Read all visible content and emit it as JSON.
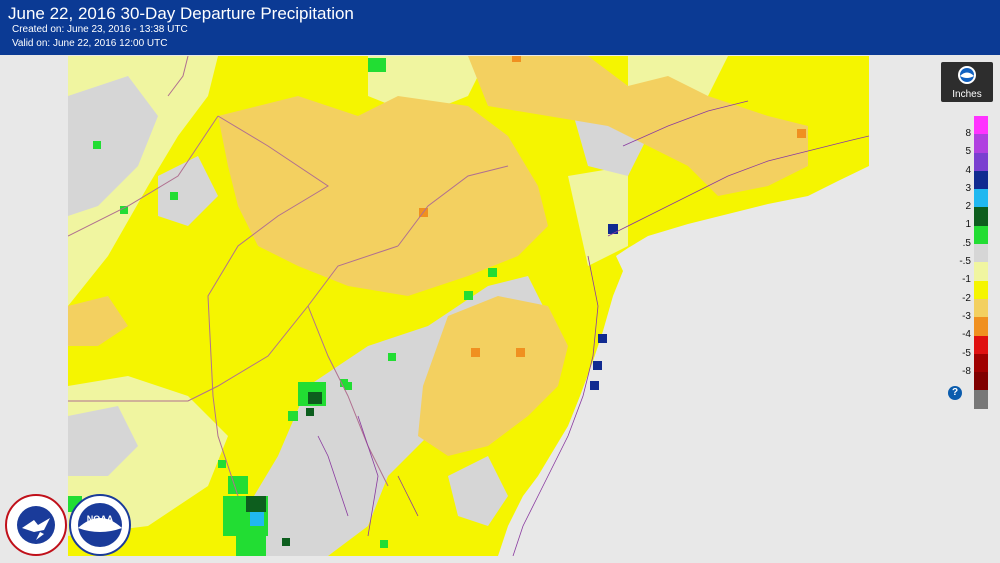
{
  "header": {
    "title": "June 22, 2016 30-Day Departure Precipitation",
    "created": "Created on: June 23, 2016 - 13:38 UTC",
    "valid": "Valid on: June 22, 2016 12:00 UTC"
  },
  "legend": {
    "units": "Inches",
    "help_label": "?",
    "entries": [
      {
        "label": "8",
        "color": "#ff33ff"
      },
      {
        "label": "5",
        "color": "#b040e0"
      },
      {
        "label": "4",
        "color": "#7a3fd0"
      },
      {
        "label": "3",
        "color": "#102a90"
      },
      {
        "label": "2",
        "color": "#20b8f0"
      },
      {
        "label": "1",
        "color": "#0d5e1e"
      },
      {
        "label": ".5",
        "color": "#22dd33"
      },
      {
        "label": "-.5",
        "color": "#d6d6d6"
      },
      {
        "label": "-1",
        "color": "#f0f5a0"
      },
      {
        "label": "-2",
        "color": "#f5f500"
      },
      {
        "label": "-3",
        "color": "#f3d060"
      },
      {
        "label": "-4",
        "color": "#f09020"
      },
      {
        "label": "-5",
        "color": "#e01010"
      },
      {
        "label": "-8",
        "color": "#a00000"
      },
      {
        "label": "",
        "color": "#800000"
      },
      {
        "label": "",
        "color": "#777777"
      }
    ]
  },
  "colors": {
    "header_bg": "#0b3a94",
    "ocean": "#e8e8e8",
    "state_lines": "#b07090",
    "rivers": "#8a3aa0"
  },
  "logos": {
    "nws_text": "NATIONAL WEATHER SERVICE",
    "noaa_text": "NOAA"
  }
}
